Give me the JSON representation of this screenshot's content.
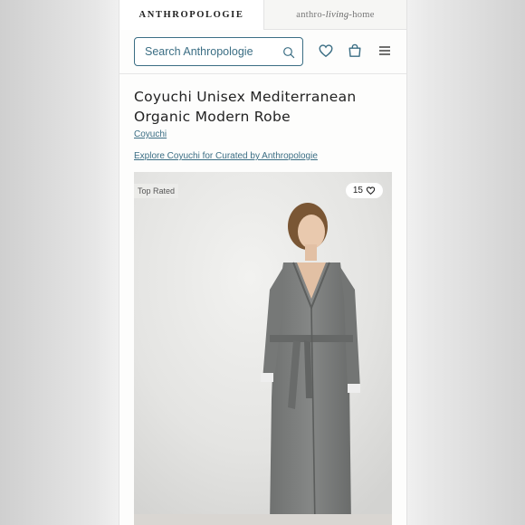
{
  "brand_tabs": {
    "primary": "ANTHROPOLOGIE",
    "secondary_prefix": "anthro-",
    "secondary_script": "living",
    "secondary_suffix": "-home"
  },
  "search": {
    "placeholder": "Search Anthropologie"
  },
  "header_icons": [
    "search-icon",
    "heart-icon",
    "shopping-bag-icon",
    "hamburger-menu-icon"
  ],
  "product": {
    "title": "Coyuchi Unisex Mediterranean Organic Modern Robe",
    "brand": "Coyuchi",
    "explore_link": "Explore Coyuchi for Curated by Anthropologie",
    "badge": "Top Rated",
    "favorites_count": "15"
  },
  "colors": {
    "accent": "#3b6e84",
    "text": "#222222",
    "robe": "#7a7c7b"
  }
}
